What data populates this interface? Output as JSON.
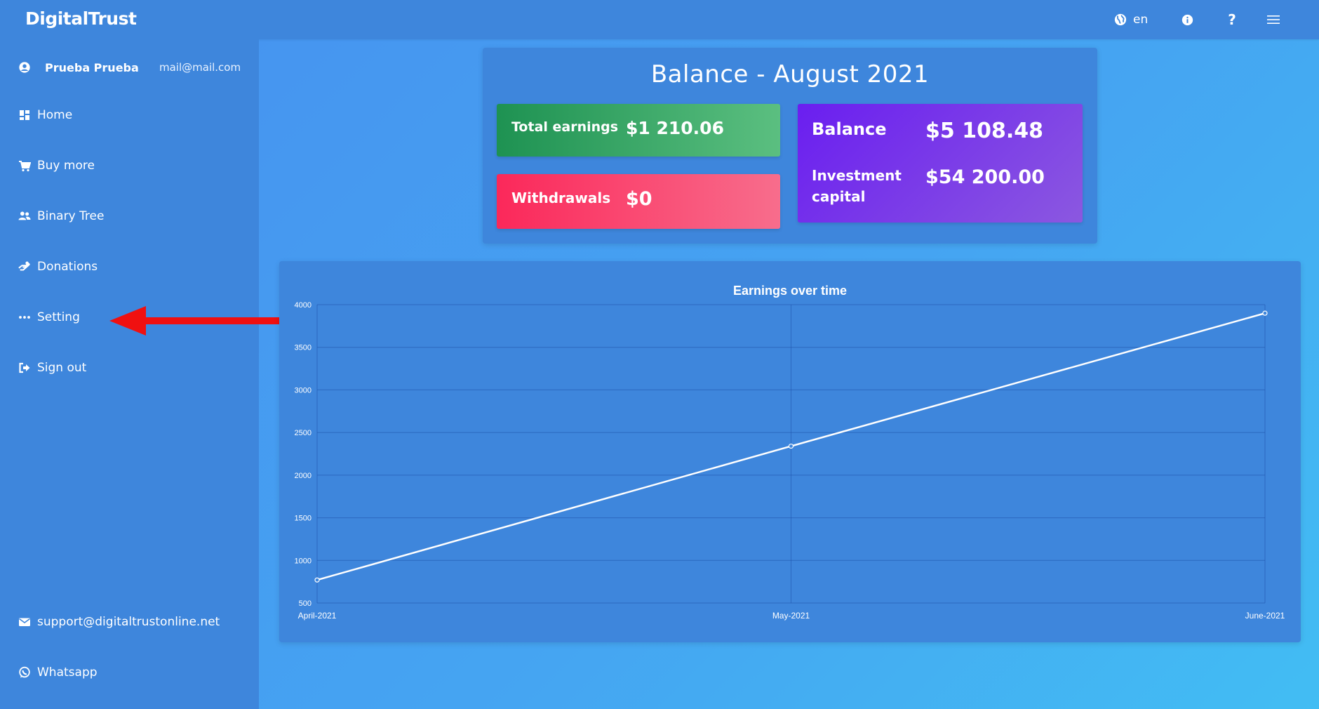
{
  "header": {
    "brand": "DigitalTrust",
    "language": "en",
    "icons": [
      "globe-icon",
      "info-icon",
      "help-icon",
      "menu-icon"
    ]
  },
  "sidebar": {
    "user": {
      "name": "Prueba Prueba",
      "email": "mail@mail.com"
    },
    "items": [
      {
        "label": "Home",
        "icon": "dashboard-icon"
      },
      {
        "label": "Buy more",
        "icon": "cart-icon"
      },
      {
        "label": "Binary Tree",
        "icon": "users-icon"
      },
      {
        "label": "Donations",
        "icon": "hand-holding-icon"
      },
      {
        "label": "Setting",
        "icon": "ellipsis-icon"
      },
      {
        "label": "Sign out",
        "icon": "sign-out-icon"
      }
    ],
    "footer": [
      {
        "label": "support@digitaltrustonline.net",
        "icon": "envelope-icon"
      },
      {
        "label": "Whatsapp",
        "icon": "whatsapp-icon"
      }
    ]
  },
  "balance": {
    "title": "Balance - August 2021",
    "total_earnings_label": "Total earnings",
    "total_earnings_value": "$1 210.06",
    "withdrawals_label": "Withdrawals",
    "withdrawals_value": "$0",
    "balance_label": "Balance",
    "balance_value": "$5 108.48",
    "investment_label_line1": "Investment",
    "investment_label_line2": "capital",
    "investment_value": "$54 200.00"
  },
  "colors": {
    "sidebar": "#3e86dc",
    "earnings_gradient": [
      "#1e9252",
      "#5bbf80"
    ],
    "withdrawals_gradient": [
      "#fb285a",
      "#f86d8c"
    ],
    "balance_gradient": [
      "#6a1ef0",
      "#8b58e0"
    ],
    "annotation_arrow": "#f01010"
  },
  "chart_data": {
    "type": "line",
    "title": "Earnings over time",
    "categories": [
      "April-2021",
      "May-2021",
      "June-2021"
    ],
    "series": [
      {
        "values": [
          770,
          2340,
          3900
        ]
      }
    ],
    "ylim": [
      500,
      4000
    ],
    "yticks": [
      500,
      1000,
      1500,
      2000,
      2500,
      3000,
      3500,
      4000
    ],
    "grid": true,
    "legend": "none"
  }
}
